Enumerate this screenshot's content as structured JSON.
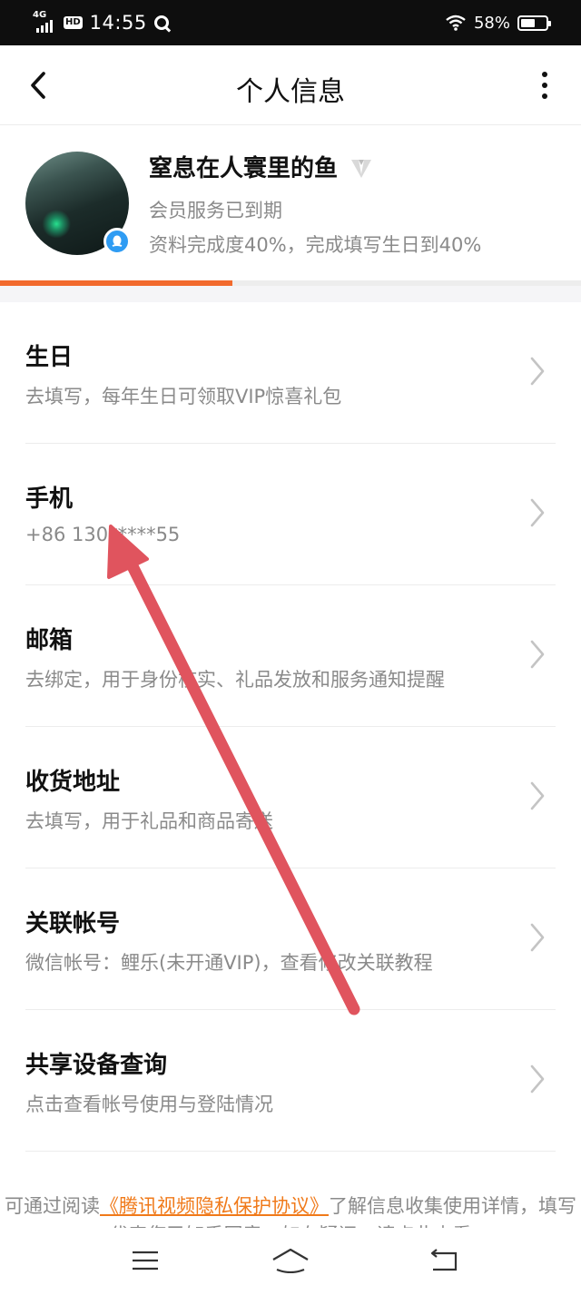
{
  "status_bar": {
    "network": "4G",
    "hd": "HD",
    "time": "14:55",
    "battery": "58%"
  },
  "header": {
    "title": "个人信息",
    "back_icon": "chevron-left-icon",
    "more_icon": "more-vertical-icon"
  },
  "profile": {
    "nickname": "窒息在人寰里的鱼",
    "member_status": "会员服务已到期",
    "completion_text": "资料完成度40%，完成填写生日到40%",
    "completion_progress": 0.4
  },
  "items": [
    {
      "title": "生日",
      "subtitle": "去填写，每年生日可领取VIP惊喜礼包"
    },
    {
      "title": "手机",
      "subtitle": "+86 130*****55"
    },
    {
      "title": "邮箱",
      "subtitle": "去绑定，用于身份核实、礼品发放和服务通知提醒"
    },
    {
      "title": "收货地址",
      "subtitle": "去填写，用于礼品和商品寄送"
    },
    {
      "title": "关联帐号",
      "subtitle": "微信帐号：鲤乐(未开通VIP)，查看修改关联教程"
    },
    {
      "title": "共享设备查询",
      "subtitle": "点击查看帐号使用与登陆情况"
    }
  ],
  "footer": {
    "prefix": "可通过阅读",
    "link": "《腾讯视频隐私保护协议》",
    "suffix": "了解信息收集使用详情，填写代表您已知悉同意，如有疑问，请点此查看"
  },
  "colors": {
    "accent": "#f26a2d",
    "link": "#f07a1a",
    "arrow": "#e0545e",
    "badge": "#2f9cf3"
  }
}
